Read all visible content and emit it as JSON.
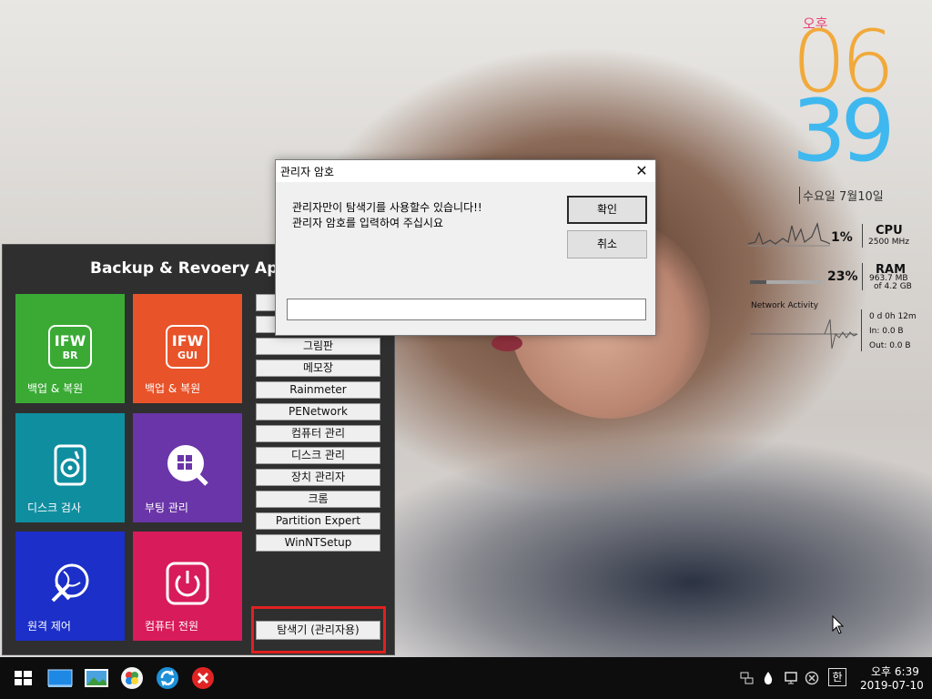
{
  "launcher": {
    "title": "Backup & Revoery App",
    "tiles": [
      {
        "label": "백업 & 복원",
        "color": "#3aaa35",
        "badge_top": "IFW",
        "badge_bottom": "BR",
        "icon": "ifw-br-icon"
      },
      {
        "label": "백업 & 복원",
        "color": "#e8532a",
        "badge_top": "IFW",
        "badge_bottom": "GUI",
        "icon": "ifw-gui-icon"
      },
      {
        "label": "디스크 검사",
        "color": "#0f8ea0",
        "icon": "disk-check-icon"
      },
      {
        "label": "부팅 관리",
        "color": "#6a35a8",
        "icon": "boot-manager-icon"
      },
      {
        "label": "원격 제어",
        "color": "#1c2fc8",
        "icon": "remote-control-icon"
      },
      {
        "label": "컴퓨터 전원",
        "color": "#d81b5a",
        "icon": "power-icon"
      }
    ],
    "side_buttons": [
      "",
      "",
      "그림판",
      "메모장",
      "Rainmeter",
      "PENetwork",
      "컴퓨터 관리",
      "디스크 관리",
      "장치 관리자",
      "크롬",
      "Partition Expert",
      "WinNTSetup"
    ],
    "explorer_button": "탐색기 (관리자용)"
  },
  "dialog": {
    "title": "관리자 암호",
    "message_line1": "관리자만이 탐색기를 사용할수 있습니다!!",
    "message_line2": "관리자 암호를 입력하여 주십시요",
    "ok_label": "확인",
    "cancel_label": "취소",
    "password_value": "",
    "close_glyph": "✕"
  },
  "clock": {
    "ampm": "오후",
    "hour": "06",
    "minute": "39",
    "date": "수요일 7월10일"
  },
  "system_monitor": {
    "cpu_percent": "1%",
    "cpu_label": "CPU",
    "cpu_speed": "2500 MHz",
    "ram_percent": "23%",
    "ram_label": "RAM",
    "ram_used": "963.7 MB",
    "ram_total": "of  4.2 GB",
    "network_label": "Network Activity",
    "uptime": "0 d 0h 12m",
    "net_in": "In: 0.0 B",
    "net_out": "Out: 0.0 B"
  },
  "taskbar": {
    "time": "오후 6:39",
    "date": "2019-07-10",
    "ime": "한",
    "apps": [
      "start-icon",
      "desktop-icon",
      "picture-icon",
      "ie-icon",
      "refresh-icon",
      "close-app-icon"
    ]
  }
}
